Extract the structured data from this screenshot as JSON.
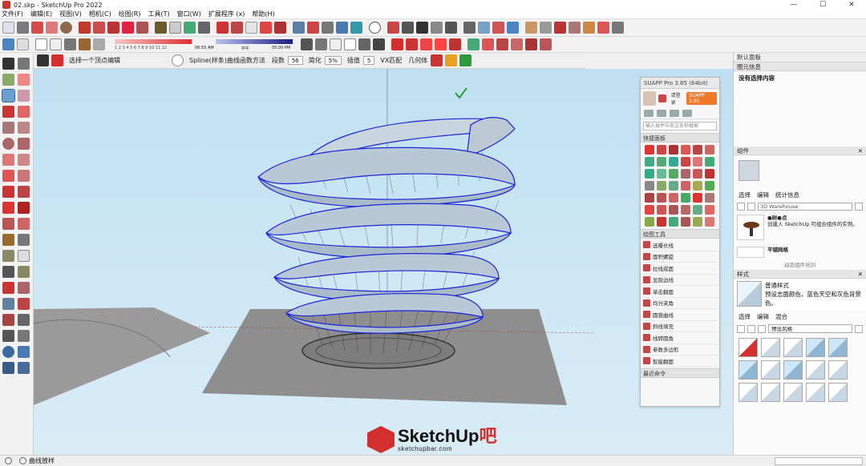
{
  "window": {
    "title": "02.skp - SketchUp Pro 2022",
    "minimize": "—",
    "maximize": "☐",
    "close": "✕"
  },
  "menu": [
    "文件(F)",
    "编辑(E)",
    "视图(V)",
    "相机(C)",
    "绘图(R)",
    "工具(T)",
    "窗口(W)",
    "扩展程序 (x)",
    "帮助(H)"
  ],
  "shadow_bar": {
    "time_left": "06:55 AM",
    "time_mid": "中午",
    "time_right": "05:00 PM",
    "months": "1 2 3 4 5 6 7 8 9 10 11 12"
  },
  "ext_strip": {
    "label": "选择一个顶点编辑",
    "spline_label": "Spline(样条)曲线函数方法",
    "segments_label": "段数",
    "segments_value": "56",
    "simplify_label": "简化",
    "simplify_value": "5%",
    "interp_label": "插值",
    "interp_value": "5",
    "vx_label": "VX匹配",
    "geom_label": "几何体"
  },
  "suapp": {
    "title": "SUAPP Pro 3.85 (64bit)",
    "login": "请登录",
    "badge": "SUAPP 3.85",
    "search_placeholder": "输入插件中英文名称搜索",
    "quick_panel": "快捷面板",
    "drawing_tools": "绘图工具",
    "recent": "最近命令",
    "tools": [
      "选曝长线",
      "面积螺旋",
      "拉线成面",
      "显隐边线",
      "单击翻面",
      "均分夹角",
      "圆锥曲线",
      "斜线填充",
      "线转圆角",
      "参数多边形",
      "智能翻面"
    ]
  },
  "tray": {
    "title": "默认面板",
    "entity_info": "图元信息",
    "no_selection": "没有选择内容",
    "components": "组件",
    "comp_tabs": [
      "选择",
      "编辑",
      "统计信息"
    ],
    "warehouse_placeholder": "3D Warehouse",
    "comp_item_title": "●树●点",
    "comp_item_desc": "创建人 SketchUp 可组合组件的实例。",
    "comp_item2_title": "平铺网格",
    "comp_note": "动态组件培训",
    "styles": "样式",
    "style_name": "普通样式",
    "style_desc": "预设志面颜色，蓝色天空和灰色背景色。",
    "style_tabs": [
      "选择",
      "编辑",
      "混合"
    ],
    "style_dropdown": "预设风格"
  },
  "status": {
    "text": "曲线放样"
  },
  "watermark": {
    "main": "SketchUp",
    "accent": "吧",
    "sub": "sketchupbar.com"
  },
  "colors": {
    "accent_red": "#d32f2f",
    "sky": "#cfe8f5",
    "ground": "#9a9a9a",
    "spiral_surface": "#b9c8d6",
    "edge_blue": "#1d25d6"
  },
  "icons": [
    "select-arrow-icon",
    "paint-bucket-icon",
    "eraser-icon",
    "pencil-icon",
    "rectangle-icon",
    "circle-icon",
    "push-pull-icon",
    "move-icon",
    "rotate-icon",
    "scale-icon",
    "tape-measure-icon",
    "orbit-icon",
    "pan-icon",
    "zoom-icon",
    "checkmark-icon"
  ]
}
